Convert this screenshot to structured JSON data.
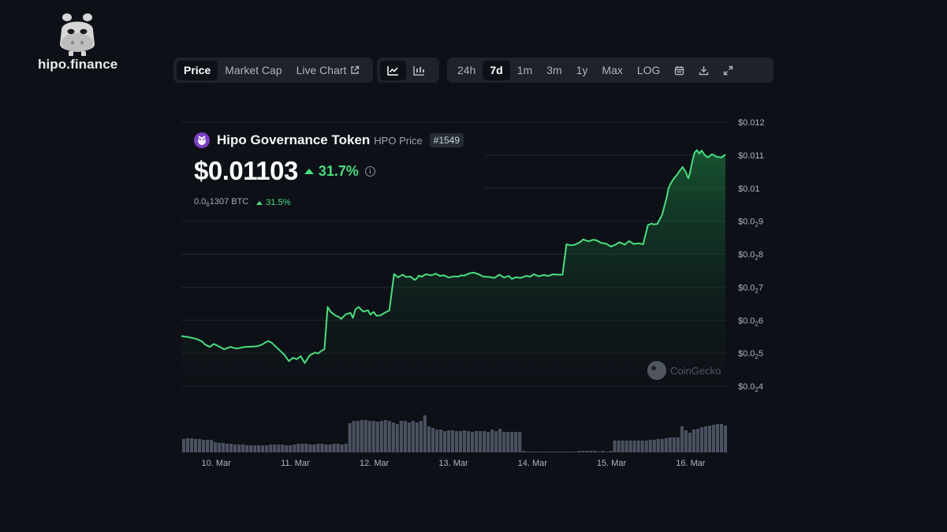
{
  "brand": {
    "name": "hipo.finance"
  },
  "toolbar": {
    "tabs": [
      "Price",
      "Market Cap",
      "Live Chart"
    ],
    "active_tab": "Price",
    "chart_types": [
      "line-chart-icon",
      "candlestick-icon"
    ],
    "ranges": [
      "24h",
      "7d",
      "1m",
      "3m",
      "1y",
      "Max",
      "LOG"
    ],
    "active_range": "7d",
    "tools": [
      "calendar-icon",
      "download-icon",
      "expand-icon"
    ]
  },
  "token": {
    "name": "Hipo Governance Token",
    "symbol_label": "HPO Price",
    "rank": "#1549",
    "price": "$0.01103",
    "change_pct": "31.7%",
    "btc_price_prefix": "0.0",
    "btc_price_sub": "6",
    "btc_price_rest": "1307 BTC",
    "btc_change_pct": "31.5%"
  },
  "watermark": "CoinGecko",
  "colors": {
    "line": "#4ade80",
    "accent_green": "#4ade80",
    "token_icon": "#7b3fc4",
    "background": "#0d1117"
  },
  "chart_data": {
    "type": "line",
    "title": "",
    "xlabel": "",
    "ylabel": "",
    "y_tick_labels": [
      {
        "value": 0.012,
        "label": "$0.012"
      },
      {
        "value": 0.011,
        "label": "$0.011"
      },
      {
        "value": 0.01,
        "label": "$0.01"
      },
      {
        "value": 0.009,
        "label": "$0.0",
        "sub": "2",
        "tail": "9"
      },
      {
        "value": 0.008,
        "label": "$0.0",
        "sub": "2",
        "tail": "8"
      },
      {
        "value": 0.007,
        "label": "$0.0",
        "sub": "2",
        "tail": "7"
      },
      {
        "value": 0.006,
        "label": "$0.0",
        "sub": "2",
        "tail": "6"
      },
      {
        "value": 0.005,
        "label": "$0.0",
        "sub": "2",
        "tail": "5"
      },
      {
        "value": 0.004,
        "label": "$0.0",
        "sub": "2",
        "tail": "4"
      }
    ],
    "ylim": [
      0.004,
      0.012
    ],
    "xlim": [
      9.56,
      16.45
    ],
    "x_ticks": [
      {
        "x": 10,
        "label": "10. Mar"
      },
      {
        "x": 11,
        "label": "11. Mar"
      },
      {
        "x": 12,
        "label": "12. Mar"
      },
      {
        "x": 13,
        "label": "13. Mar"
      },
      {
        "x": 14,
        "label": "14. Mar"
      },
      {
        "x": 15,
        "label": "15. Mar"
      },
      {
        "x": 16,
        "label": "16. Mar"
      }
    ],
    "grid": true,
    "series": [
      {
        "x": [
          9.56,
          9.66,
          9.74,
          9.82,
          9.86,
          9.92,
          9.97,
          10.03,
          10.1,
          10.18,
          10.26,
          10.36,
          10.46,
          10.52,
          10.58,
          10.62,
          10.66,
          10.7,
          10.78,
          10.86,
          10.92,
          10.97,
          11.02,
          11.07,
          11.12,
          11.18,
          11.25,
          11.29,
          11.33,
          11.37,
          11.41,
          11.45,
          11.51,
          11.55,
          11.58,
          11.64,
          11.7,
          11.73,
          11.76,
          11.8,
          11.86,
          11.92,
          11.95,
          11.99,
          12.03,
          12.08,
          12.13,
          12.19,
          12.25,
          12.3,
          12.36,
          12.4,
          12.46,
          12.51,
          12.54,
          12.56,
          12.6,
          12.65,
          12.72,
          12.78,
          12.83,
          12.88,
          12.94,
          13.01,
          13.06,
          13.1,
          13.14,
          13.2,
          13.26,
          13.32,
          13.38,
          13.45,
          13.52,
          13.58,
          13.64,
          13.7,
          13.74,
          13.79,
          13.85,
          13.92,
          13.97,
          14.02,
          14.08,
          14.14,
          14.2,
          14.26,
          14.32,
          14.38,
          14.43,
          14.48,
          14.54,
          14.6,
          14.64,
          14.66,
          14.71,
          14.77,
          14.81,
          14.87,
          14.93,
          14.99,
          15.05,
          15.1,
          15.17,
          15.22,
          15.28,
          15.34,
          15.4,
          15.46,
          15.51,
          15.53,
          15.58,
          15.64,
          15.7,
          15.72,
          15.75,
          15.79,
          15.82,
          15.86,
          15.9,
          15.94,
          15.97,
          15.99,
          16.02,
          16.05,
          16.08,
          16.11,
          16.14,
          16.18,
          16.22,
          16.27,
          16.33,
          16.39,
          16.44
        ],
        "y": [
          0.00552,
          0.00548,
          0.00544,
          0.00536,
          0.00526,
          0.00519,
          0.00528,
          0.00521,
          0.00512,
          0.00519,
          0.00514,
          0.00519,
          0.0052,
          0.00521,
          0.00526,
          0.00532,
          0.00537,
          0.00532,
          0.00514,
          0.00496,
          0.00476,
          0.00486,
          0.00482,
          0.00491,
          0.0047,
          0.00493,
          0.00502,
          0.00499,
          0.00507,
          0.00512,
          0.0064,
          0.00625,
          0.00614,
          0.0061,
          0.00604,
          0.00618,
          0.00622,
          0.00607,
          0.00632,
          0.0064,
          0.00626,
          0.0063,
          0.00617,
          0.00625,
          0.00613,
          0.00615,
          0.00622,
          0.0063,
          0.0074,
          0.0073,
          0.00738,
          0.00731,
          0.00732,
          0.00722,
          0.00727,
          0.00735,
          0.00732,
          0.00739,
          0.00736,
          0.00741,
          0.00734,
          0.00736,
          0.00729,
          0.00733,
          0.00732,
          0.00736,
          0.00735,
          0.00742,
          0.00744,
          0.00739,
          0.00732,
          0.00731,
          0.00728,
          0.00738,
          0.00729,
          0.00734,
          0.00725,
          0.0073,
          0.00728,
          0.00734,
          0.00732,
          0.00739,
          0.00733,
          0.00737,
          0.00734,
          0.00739,
          0.00738,
          0.00738,
          0.0083,
          0.00827,
          0.00829,
          0.00836,
          0.00845,
          0.00843,
          0.00839,
          0.00844,
          0.00842,
          0.00834,
          0.00832,
          0.00823,
          0.00829,
          0.00836,
          0.00829,
          0.0084,
          0.00831,
          0.00833,
          0.0083,
          0.00888,
          0.00893,
          0.0089,
          0.00892,
          0.0092,
          0.00975,
          0.01,
          0.01015,
          0.0103,
          0.01038,
          0.01052,
          0.01064,
          0.01048,
          0.0103,
          0.01045,
          0.0108,
          0.01108,
          0.01115,
          0.01105,
          0.01114,
          0.011,
          0.01093,
          0.01103,
          0.01095,
          0.01093,
          0.01102
        ]
      }
    ],
    "volume": {
      "x": [
        9.59,
        9.64,
        9.69,
        9.74,
        9.79,
        9.84,
        9.89,
        9.94,
        9.99,
        10.04,
        10.09,
        10.14,
        10.19,
        10.24,
        10.29,
        10.34,
        10.39,
        10.44,
        10.49,
        10.54,
        10.59,
        10.64,
        10.69,
        10.74,
        10.79,
        10.84,
        10.89,
        10.94,
        10.99,
        11.04,
        11.09,
        11.14,
        11.19,
        11.24,
        11.29,
        11.34,
        11.39,
        11.44,
        11.49,
        11.54,
        11.59,
        11.64,
        11.69,
        11.74,
        11.79,
        11.84,
        11.89,
        11.94,
        11.99,
        12.04,
        12.09,
        12.14,
        12.19,
        12.24,
        12.29,
        12.34,
        12.39,
        12.44,
        12.49,
        12.54,
        12.59,
        12.64,
        12.69,
        12.74,
        12.79,
        12.84,
        12.89,
        12.94,
        12.99,
        13.04,
        13.09,
        13.14,
        13.19,
        13.24,
        13.29,
        13.34,
        13.39,
        13.44,
        13.49,
        13.54,
        13.59,
        13.64,
        13.69,
        13.74,
        13.79,
        13.84,
        13.89,
        13.94,
        13.99,
        14.04,
        14.09,
        14.14,
        14.19,
        14.24,
        14.29,
        14.34,
        14.39,
        14.44,
        14.49,
        14.54,
        14.59,
        14.64,
        14.69,
        14.74,
        14.79,
        14.84,
        14.89,
        14.94,
        14.99,
        15.04,
        15.09,
        15.14,
        15.19,
        15.24,
        15.29,
        15.34,
        15.39,
        15.44,
        15.49,
        15.54,
        15.59,
        15.64,
        15.69,
        15.74,
        15.79,
        15.84,
        15.89,
        15.94,
        15.99,
        16.04,
        16.09,
        16.14,
        16.19,
        16.24,
        16.29,
        16.34,
        16.39,
        16.44
      ],
      "values": [
        17,
        18,
        18,
        17,
        17,
        16,
        16,
        16,
        13,
        12,
        12,
        11,
        11,
        10,
        10,
        10,
        9,
        9,
        9,
        9,
        9,
        9,
        10,
        10,
        10,
        10,
        9,
        9,
        10,
        11,
        11,
        11,
        10,
        10,
        11,
        11,
        10,
        10,
        11,
        11,
        10,
        11,
        37,
        40,
        40,
        41,
        41,
        40,
        40,
        39,
        40,
        41,
        40,
        38,
        36,
        40,
        40,
        38,
        40,
        38,
        40,
        47,
        33,
        31,
        29,
        29,
        27,
        28,
        28,
        27,
        27,
        28,
        27,
        26,
        27,
        27,
        27,
        26,
        29,
        27,
        30,
        26,
        26,
        26,
        26,
        26,
        2,
        1,
        1,
        1,
        1,
        1,
        1,
        1,
        1,
        1,
        1,
        1,
        1,
        1,
        2,
        2,
        2,
        2,
        2,
        1,
        2,
        1,
        2,
        15,
        15,
        15,
        15,
        15,
        15,
        15,
        15,
        15,
        16,
        16,
        17,
        17,
        18,
        19,
        19,
        19,
        33,
        28,
        25,
        29,
        30,
        32,
        33,
        34,
        35,
        36,
        36,
        34,
        34,
        33,
        32,
        28
      ]
    }
  }
}
